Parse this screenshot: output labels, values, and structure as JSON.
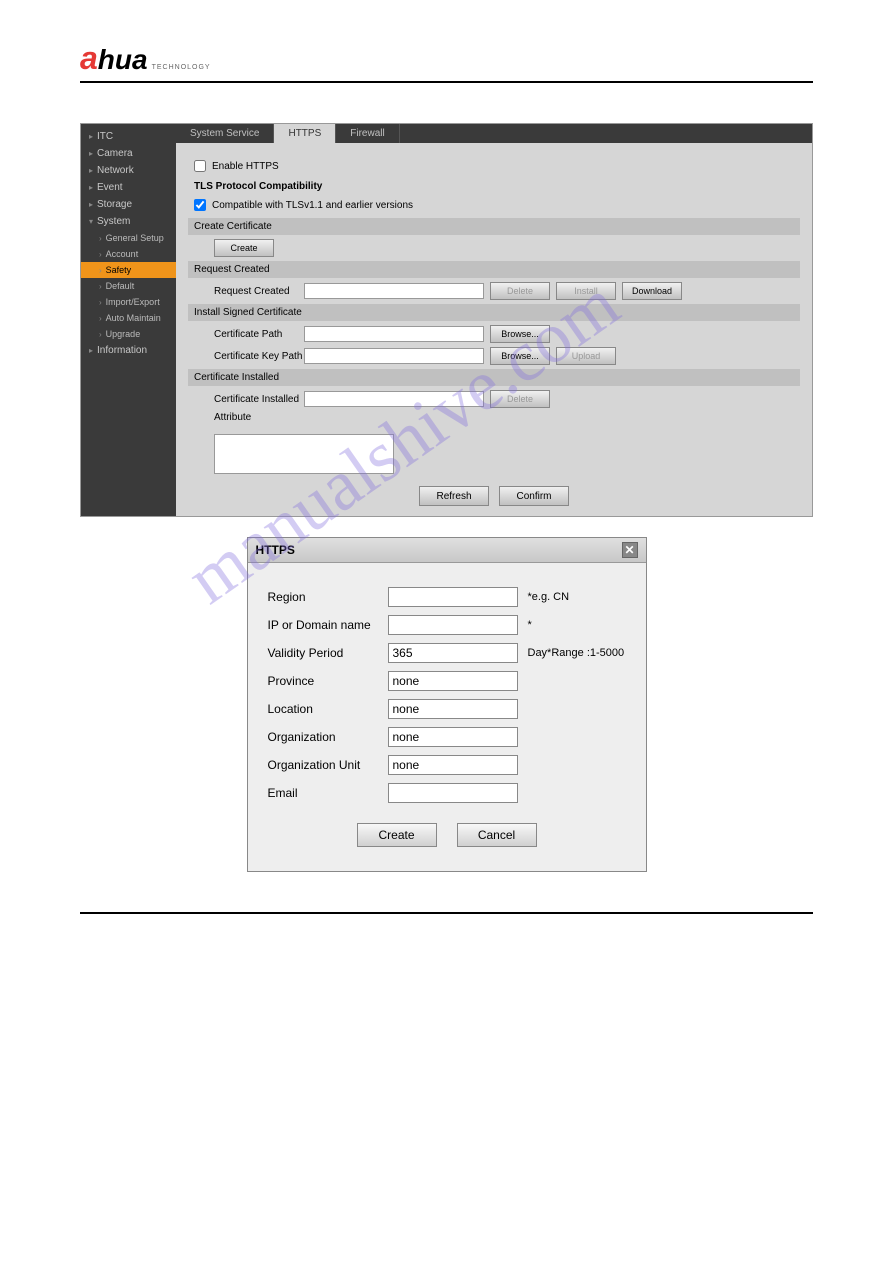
{
  "logo": {
    "prefix": "a",
    "text": "hua",
    "sub": "TECHNOLOGY"
  },
  "sidebar": {
    "items": [
      {
        "label": "ITC"
      },
      {
        "label": "Camera"
      },
      {
        "label": "Network"
      },
      {
        "label": "Event"
      },
      {
        "label": "Storage"
      },
      {
        "label": "System"
      }
    ],
    "subitems": [
      {
        "label": "General Setup"
      },
      {
        "label": "Account"
      },
      {
        "label": "Safety"
      },
      {
        "label": "Default"
      },
      {
        "label": "Import/Export"
      },
      {
        "label": "Auto Maintain"
      },
      {
        "label": "Upgrade"
      }
    ],
    "lastItem": {
      "label": "Information"
    }
  },
  "tabs": [
    {
      "label": "System Service"
    },
    {
      "label": "HTTPS"
    },
    {
      "label": "Firewall"
    }
  ],
  "httpsPanel": {
    "enableHttps": "Enable HTTPS",
    "tlsHeader": "TLS Protocol Compatibility",
    "compatible": "Compatible with TLSv1.1 and earlier versions",
    "createCertHeader": "Create Certificate",
    "createBtn": "Create",
    "requestCreatedHeader": "Request Created",
    "requestCreatedLabel": "Request Created",
    "deleteBtn": "Delete",
    "installBtn": "Install",
    "downloadBtn": "Download",
    "installSignedHeader": "Install Signed Certificate",
    "certPathLabel": "Certificate Path",
    "certKeyPathLabel": "Certificate Key Path",
    "browseBtn": "Browse...",
    "uploadBtn": "Upload",
    "certInstalledHeader": "Certificate Installed",
    "certInstalledLabel": "Certificate Installed",
    "attributeLabel": "Attribute",
    "refreshBtn": "Refresh",
    "confirmBtn": "Confirm"
  },
  "dialog": {
    "title": "HTTPS",
    "region": {
      "label": "Region",
      "value": "",
      "hint": "*e.g. CN"
    },
    "ipDomain": {
      "label": "IP or Domain name",
      "value": "",
      "hint": "*"
    },
    "validity": {
      "label": "Validity Period",
      "value": "365",
      "hint": "Day*Range :1-5000"
    },
    "province": {
      "label": "Province",
      "value": "none"
    },
    "location": {
      "label": "Location",
      "value": "none"
    },
    "organization": {
      "label": "Organization",
      "value": "none"
    },
    "orgUnit": {
      "label": "Organization Unit",
      "value": "none"
    },
    "email": {
      "label": "Email",
      "value": ""
    },
    "createBtn": "Create",
    "cancelBtn": "Cancel"
  },
  "watermark": "manualshive.com"
}
